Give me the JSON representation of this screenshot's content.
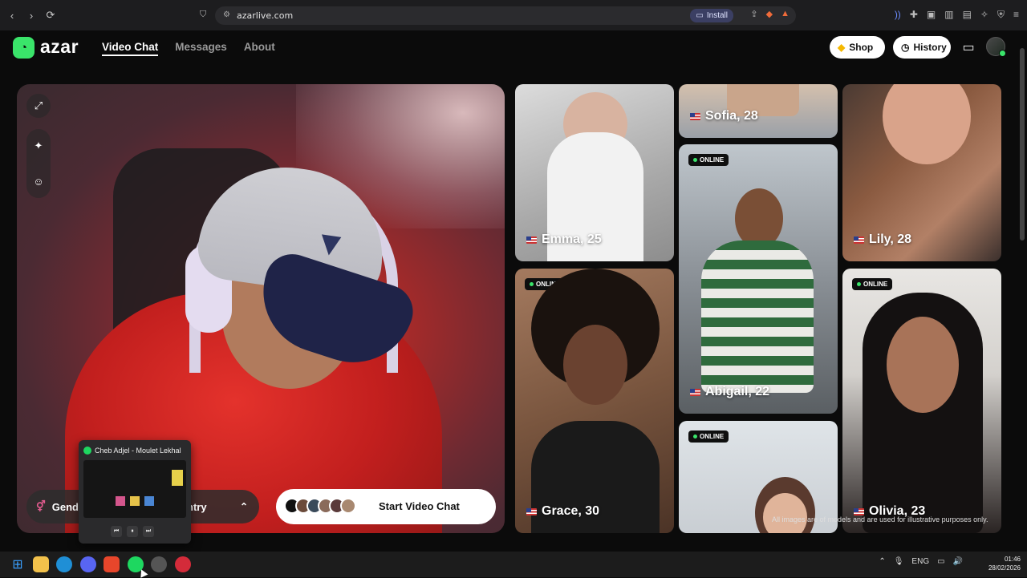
{
  "browser": {
    "url": "azarlive.com",
    "install_label": "Install"
  },
  "site": {
    "logo_text": "azar",
    "nav": [
      {
        "label": "Video Chat",
        "active": true
      },
      {
        "label": "Messages",
        "active": false
      },
      {
        "label": "About",
        "active": false
      }
    ],
    "shop_label": "Shop",
    "history_label": "History"
  },
  "video": {
    "gender_label": "Gend",
    "country_label": "ntry",
    "start_label": "Start Video Chat"
  },
  "profiles": [
    {
      "name": "Emma, 25",
      "online": false
    },
    {
      "name": "Sofia, 28",
      "online": false
    },
    {
      "name": "Lily, 28",
      "online": false
    },
    {
      "name": "Abigail, 22",
      "online": true
    },
    {
      "name": "Grace, 30",
      "online": true
    },
    {
      "name": "Olivia, 23",
      "online": true
    },
    {
      "name": "",
      "online": true
    }
  ],
  "online_label": "ONLINE",
  "disclaimer": "All images are of models and are used for illustrative purposes only.",
  "media_player": {
    "track": "Cheb Adjel - Moulet Lekhal"
  },
  "taskbar": {
    "lang": "ENG",
    "time": "01:46",
    "date": "28/02/2026"
  },
  "colors": {
    "brand_green": "#3ae46a",
    "background": "#0b0b0b"
  }
}
